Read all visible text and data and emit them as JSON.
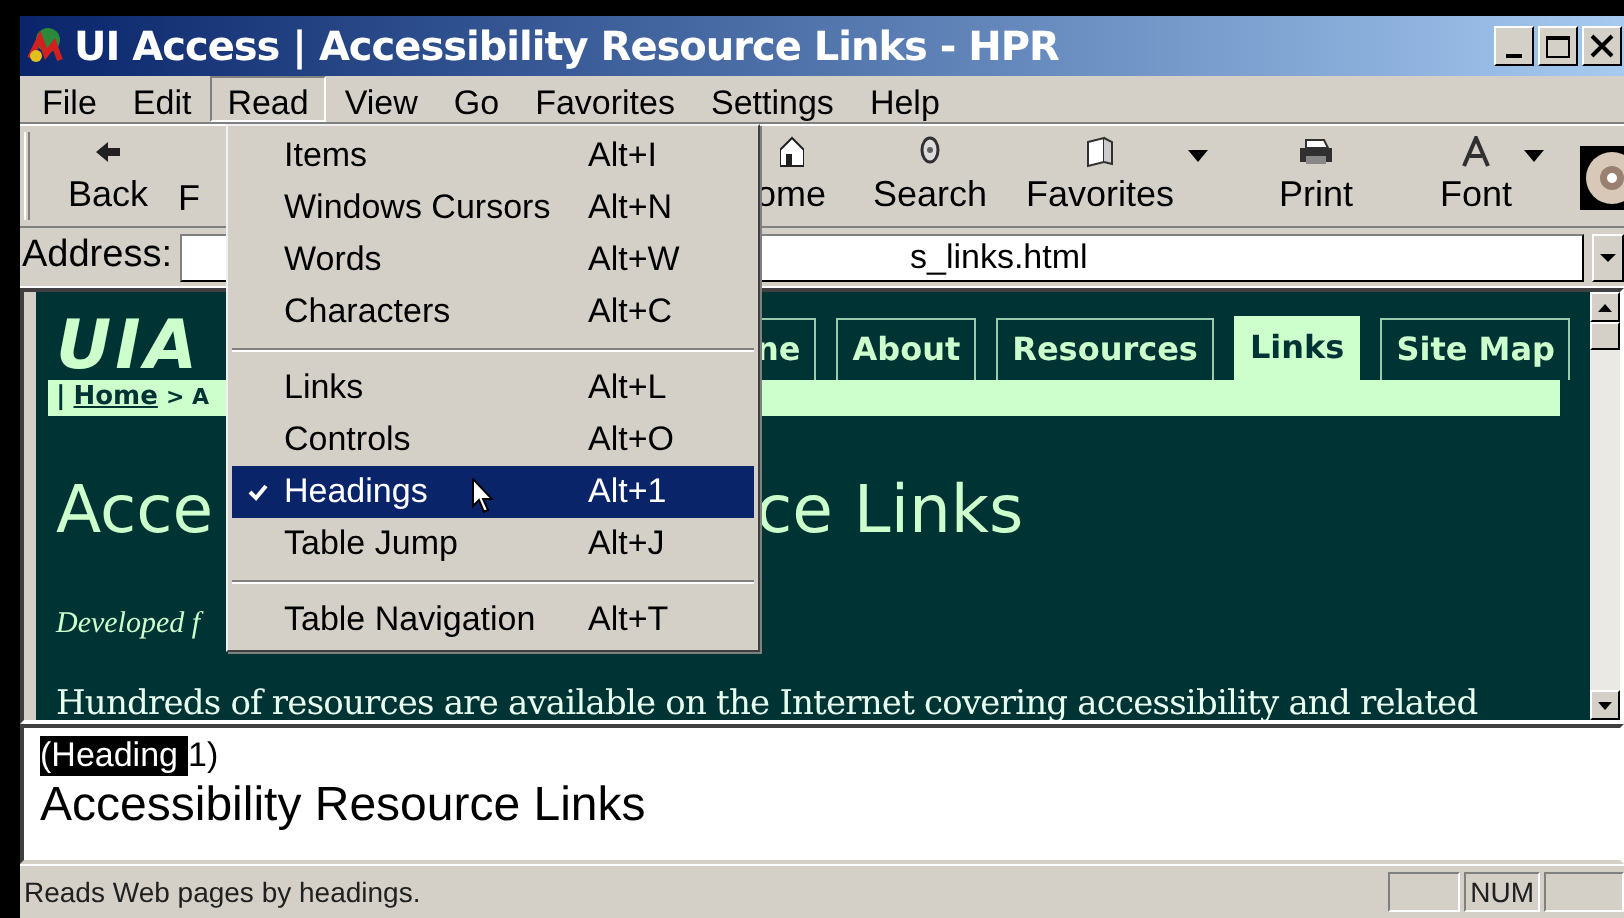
{
  "window": {
    "title": "UI Access | Accessibility Resource Links - HPR"
  },
  "menu_bar": [
    {
      "label": "File",
      "selected": false
    },
    {
      "label": "Edit",
      "selected": false
    },
    {
      "label": "Read",
      "selected": true
    },
    {
      "label": "View",
      "selected": false
    },
    {
      "label": "Go",
      "selected": false
    },
    {
      "label": "Favorites",
      "selected": false
    },
    {
      "label": "Settings",
      "selected": false
    },
    {
      "label": "Help",
      "selected": false
    }
  ],
  "toolbar": [
    {
      "label": "Back",
      "kind": "back"
    },
    {
      "label": "F",
      "kind": "cut"
    },
    {
      "label": "ome",
      "kind": "home"
    },
    {
      "label": "Search",
      "kind": "search"
    },
    {
      "label": "Favorites",
      "kind": "favorites",
      "dropdown": true
    },
    {
      "label": "Print",
      "kind": "print"
    },
    {
      "label": "Font",
      "kind": "font",
      "dropdown": true
    }
  ],
  "address": {
    "label": "Address:",
    "value": "s_links.html"
  },
  "page": {
    "logo": "UIA",
    "breadcrumb": {
      "separator": "|",
      "link": "Home",
      "rest": "> A"
    },
    "tabs": [
      {
        "label": "ne",
        "selected": false
      },
      {
        "label": "About",
        "selected": false
      },
      {
        "label": "Resources",
        "selected": false
      },
      {
        "label": "Links",
        "selected": true
      },
      {
        "label": "Site Map",
        "selected": false
      }
    ],
    "heading": [
      "Acce",
      "ce Links"
    ],
    "subtitle": "Developed f",
    "paragraph": "Hundreds of resources are available on the Internet covering accessibility and related"
  },
  "read_menu": [
    {
      "kind": "item",
      "label": "Items",
      "shortcut": "Alt+I",
      "checked": false,
      "selected": false
    },
    {
      "kind": "item",
      "label": "Windows Cursors",
      "shortcut": "Alt+N",
      "checked": false,
      "selected": false
    },
    {
      "kind": "item",
      "label": "Words",
      "shortcut": "Alt+W",
      "checked": false,
      "selected": false
    },
    {
      "kind": "item",
      "label": "Characters",
      "shortcut": "Alt+C",
      "checked": false,
      "selected": false
    },
    {
      "kind": "separator"
    },
    {
      "kind": "item",
      "label": "Links",
      "shortcut": "Alt+L",
      "checked": false,
      "selected": false
    },
    {
      "kind": "item",
      "label": "Controls",
      "shortcut": "Alt+O",
      "checked": false,
      "selected": false
    },
    {
      "kind": "item",
      "label": "Headings",
      "shortcut": "Alt+1",
      "checked": true,
      "selected": true
    },
    {
      "kind": "item",
      "label": "Table Jump",
      "shortcut": "Alt+J",
      "checked": false,
      "selected": false
    },
    {
      "kind": "separator"
    },
    {
      "kind": "item",
      "label": "Table Navigation",
      "shortcut": "Alt+T",
      "checked": false,
      "selected": false
    }
  ],
  "reading_pane": {
    "highlighted": "(Heading",
    "rest": "1)",
    "text": "Accessibility Resource Links"
  },
  "status_bar": {
    "message": "Reads Web pages by headings.",
    "panels": [
      {
        "label": "NUM"
      }
    ]
  }
}
